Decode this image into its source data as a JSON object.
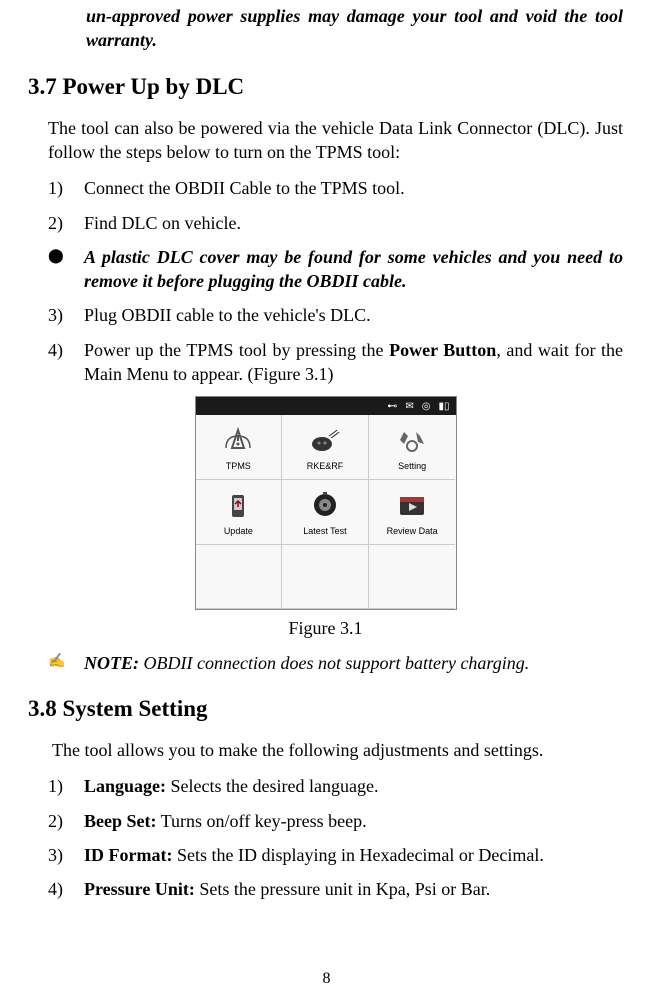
{
  "warning_cont": "un-approved power supplies may damage your tool and void the tool warranty.",
  "section37": {
    "heading": "3.7 Power Up by DLC",
    "intro": "The tool can also be powered via the vehicle Data Link Connector (DLC). Just follow the steps below to turn on the TPMS tool:",
    "step1_num": "1)",
    "step1_text": "Connect the OBDII Cable to the TPMS tool.",
    "step2_num": "2)",
    "step2_text": "Find DLC on vehicle.",
    "bullet_text": "A plastic DLC cover may be found for some vehicles and you need to remove it before plugging the OBDII cable.",
    "step3_num": "3)",
    "step3_text": "Plug OBDII cable to the vehicle's DLC.",
    "step4_num": "4)",
    "step4_pre": "Power up the TPMS tool by pressing the ",
    "step4_bold": "Power Button",
    "step4_post": ", and wait for the Main Menu to appear. (Figure 3.1)",
    "figure_caption": "Figure 3.1",
    "note_label": "NOTE:",
    "note_text": " OBDII connection does not support battery charging."
  },
  "menu_grid": {
    "items": [
      {
        "label": "TPMS"
      },
      {
        "label": "RKE&RF"
      },
      {
        "label": "Setting"
      },
      {
        "label": "Update"
      },
      {
        "label": "Latest Test"
      },
      {
        "label": "Review Data"
      }
    ]
  },
  "section38": {
    "heading": "3.8 System Setting",
    "intro": "The tool allows you to make the following adjustments and settings.",
    "item1_num": "1)",
    "item1_bold": "Language:",
    "item1_text": " Selects the desired language.",
    "item2_num": "2)",
    "item2_bold": "Beep Set:",
    "item2_text": " Turns on/off key-press beep.",
    "item3_num": "3)",
    "item3_bold": "ID Format:",
    "item3_text": " Sets the ID displaying in Hexadecimal or Decimal.",
    "item4_num": "4)",
    "item4_bold": "Pressure Unit:",
    "item4_text": " Sets the pressure unit in Kpa, Psi or Bar."
  },
  "page_number": "8"
}
